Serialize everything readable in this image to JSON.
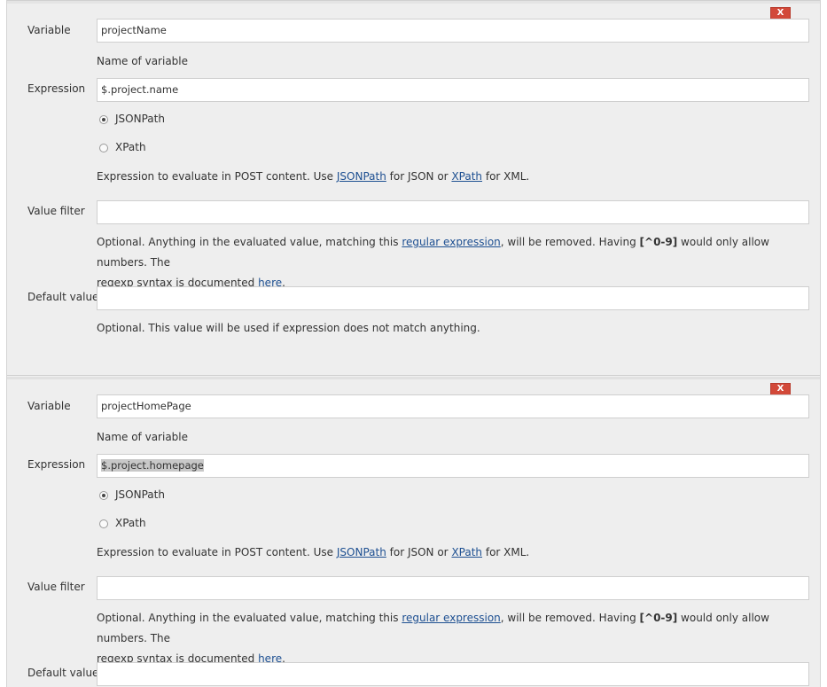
{
  "delete_label": "X",
  "labels": {
    "variable": "Variable",
    "expression": "Expression",
    "value_filter": "Value filter",
    "default_value": "Default value"
  },
  "help": {
    "variable_name": "Name of variable",
    "expression_prefix": "Expression to evaluate in POST content. Use ",
    "jsonpath_link": "JSONPath",
    "expression_mid": " for JSON or ",
    "xpath_link": "XPath",
    "expression_suffix": " for XML.",
    "filter_prefix": "Optional. Anything in the evaluated value, matching this ",
    "regex_link": "regular expression",
    "filter_mid": ", will be removed. Having ",
    "filter_code": "[^0-9]",
    "filter_line1_end": " would only allow numbers. The",
    "filter_line2_prefix": "regexp syntax is documented ",
    "here_link": "here",
    "filter_line2_suffix": ".",
    "default_help": "Optional. This value will be used if expression does not match anything."
  },
  "radio_options": {
    "jsonpath": "JSONPath",
    "xpath": "XPath"
  },
  "variables": [
    {
      "variable": "projectName",
      "expression": "$.project.name",
      "selected_type": "JSONPath",
      "value_filter": "",
      "default_value": ""
    },
    {
      "variable": "projectHomePage",
      "expression": "$.project.homepage",
      "selected_type": "JSONPath",
      "value_filter": "",
      "default_value": ""
    }
  ]
}
